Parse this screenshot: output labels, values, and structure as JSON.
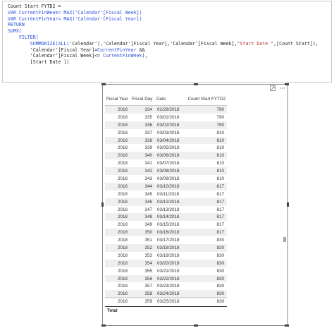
{
  "formula": {
    "line1": "Count Start FYTD2 =",
    "line2_kw": "VAR",
    "line2_rest": " CurrentFinWeek= ",
    "line2_fn": "MAX",
    "line2_arg": "('Calendar'[Fiscal Week])",
    "line3_kw": "VAR",
    "line3_rest": " CurrentFinYear= ",
    "line3_fn": "MAX",
    "line3_arg": "('Calendar'[Fiscal Year])",
    "line4": "RETURN",
    "line5": "SUMX(",
    "line6": "    FILTER(",
    "line7_fn": "        SUMMARIZE(ALL(",
    "line7_a": "'Calendar'",
    "line7_b": "),'Calendar'[Fiscal Year],'Calendar'[Fiscal Week],",
    "line7_str": "\"Start Date \"",
    "line7_c": ",[Count Start]),",
    "line8": "        'Calendar'[Fiscal Year]=",
    "line8_var": "CurrentFinYear",
    "line8_end": " &&",
    "line9": "        'Calendar'[Fiscal Week]<= ",
    "line9_var": "CurrentFinWeek",
    "line9_end": "),",
    "line10": "        [Start Date ])"
  },
  "table": {
    "headers": [
      "Fiscal Year",
      "Fiscal Day",
      "Date",
      "Count Start FYTD2"
    ],
    "rows": [
      [
        "2018",
        "334",
        "02/28/2018",
        "790"
      ],
      [
        "2018",
        "335",
        "03/01/2018",
        "790"
      ],
      [
        "2018",
        "336",
        "03/02/2018",
        "790"
      ],
      [
        "2018",
        "337",
        "03/03/2018",
        "810"
      ],
      [
        "2018",
        "338",
        "03/04/2018",
        "810"
      ],
      [
        "2018",
        "339",
        "03/05/2018",
        "810"
      ],
      [
        "2018",
        "340",
        "03/06/2018",
        "810"
      ],
      [
        "2018",
        "341",
        "03/07/2018",
        "810"
      ],
      [
        "2018",
        "342",
        "03/08/2018",
        "810"
      ],
      [
        "2018",
        "343",
        "03/09/2018",
        "810"
      ],
      [
        "2018",
        "344",
        "03/10/2018",
        "817"
      ],
      [
        "2018",
        "345",
        "03/11/2018",
        "817"
      ],
      [
        "2018",
        "346",
        "03/12/2018",
        "817"
      ],
      [
        "2018",
        "347",
        "03/13/2018",
        "817"
      ],
      [
        "2018",
        "348",
        "03/14/2018",
        "817"
      ],
      [
        "2018",
        "349",
        "03/15/2018",
        "817"
      ],
      [
        "2018",
        "350",
        "03/16/2018",
        "817"
      ],
      [
        "2018",
        "351",
        "03/17/2018",
        "830"
      ],
      [
        "2018",
        "352",
        "03/18/2018",
        "830"
      ],
      [
        "2018",
        "353",
        "03/19/2018",
        "830"
      ],
      [
        "2018",
        "354",
        "03/20/2018",
        "830"
      ],
      [
        "2018",
        "355",
        "03/21/2018",
        "830"
      ],
      [
        "2018",
        "356",
        "03/22/2018",
        "830"
      ],
      [
        "2018",
        "357",
        "03/23/2018",
        "830"
      ],
      [
        "2018",
        "358",
        "03/24/2018",
        "830"
      ],
      [
        "2018",
        "359",
        "03/25/2018",
        "830"
      ]
    ],
    "total_label": "Total"
  },
  "icons": {
    "focus": "focus-mode-icon",
    "more": "more-options-icon"
  },
  "colors": {
    "keyword": "#2a4fd8",
    "string": "#b5352a",
    "row_alt": "#efefef",
    "border": "#8a8a8a"
  }
}
